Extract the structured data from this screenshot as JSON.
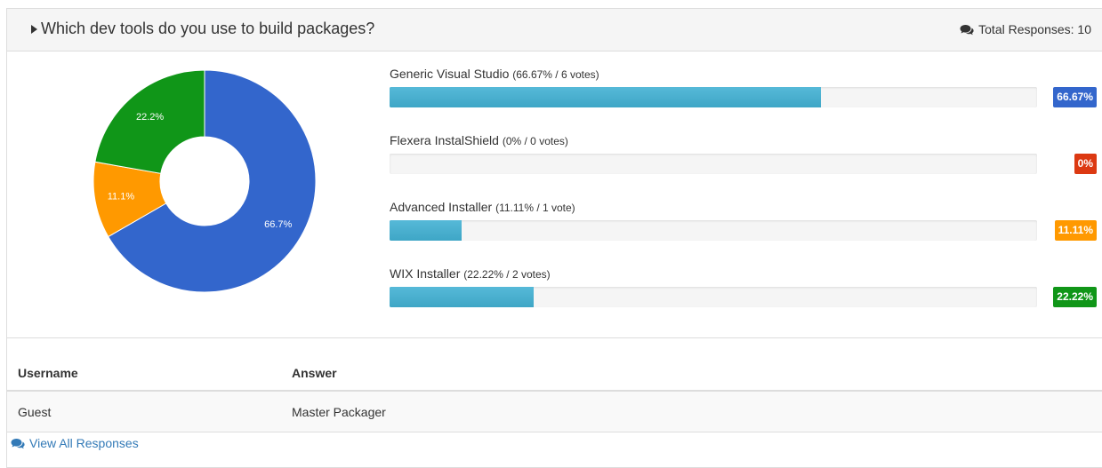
{
  "question": {
    "title": "Which dev tools do you use to build packages?",
    "total_responses": "Total Responses: 10"
  },
  "colors": {
    "blue": "#3366cc",
    "red": "#dc3912",
    "orange": "#ff9900",
    "green": "#109618",
    "bar_fill": "#4fb0d0"
  },
  "chart_data": {
    "type": "pie",
    "donut": true,
    "labels": [
      "Generic Visual Studio",
      "Flexera InstalShield",
      "Advanced Installer",
      "WIX Installer"
    ],
    "values": [
      6,
      0,
      1,
      2
    ],
    "slice_labels": [
      "66.7%",
      "",
      "11.1%",
      "22.2%"
    ],
    "colors": [
      "#3366cc",
      "#dc3912",
      "#ff9900",
      "#109618"
    ]
  },
  "options": [
    {
      "name": "Generic Visual Studio",
      "detail": "(66.67% / 6 votes)",
      "percent": 66.67,
      "badge": "66.67%",
      "color": "#3366cc"
    },
    {
      "name": "Flexera InstalShield",
      "detail": "(0% / 0 votes)",
      "percent": 0,
      "badge": "0%",
      "color": "#dc3912"
    },
    {
      "name": "Advanced Installer",
      "detail": "(11.11% / 1 vote)",
      "percent": 11.11,
      "badge": "11.11%",
      "color": "#ff9900"
    },
    {
      "name": "WIX Installer",
      "detail": "(22.22% / 2 votes)",
      "percent": 22.22,
      "badge": "22.22%",
      "color": "#109618"
    }
  ],
  "table": {
    "headers": {
      "username": "Username",
      "answer": "Answer"
    },
    "rows": [
      {
        "username": "Guest",
        "answer": "Master Packager"
      }
    ]
  },
  "footer": {
    "link": "View All Responses",
    "icon": "comments-icon"
  }
}
